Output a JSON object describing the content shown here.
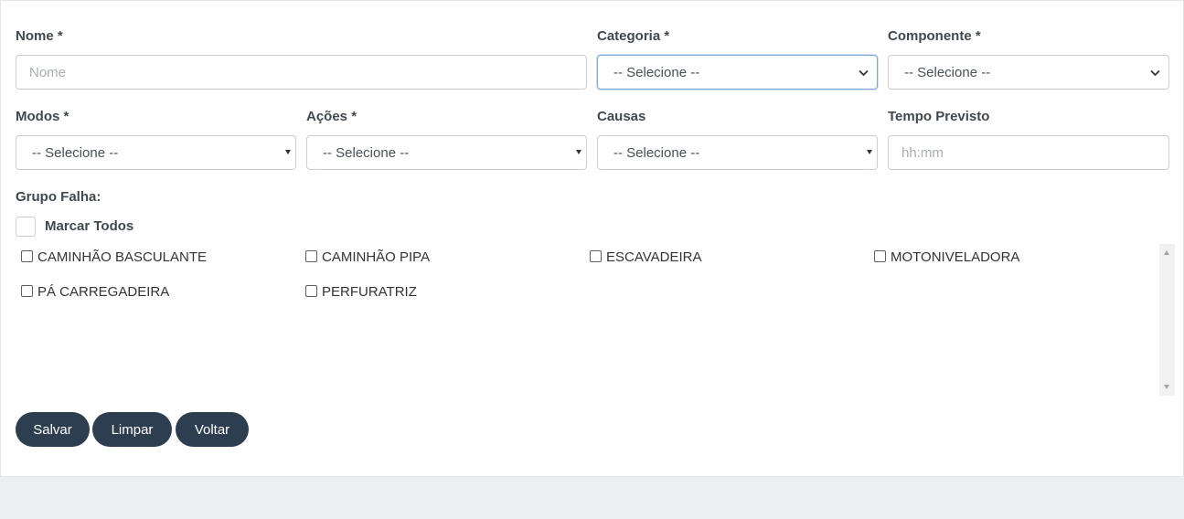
{
  "form": {
    "nome": {
      "label": "Nome *",
      "placeholder": "Nome"
    },
    "categoria": {
      "label": "Categoria *",
      "value": "-- Selecione --"
    },
    "componente": {
      "label": "Componente *",
      "value": "-- Selecione --"
    },
    "modos": {
      "label": "Modos *",
      "value": "-- Selecione --"
    },
    "acoes": {
      "label": "Ações *",
      "value": "-- Selecione --"
    },
    "causas": {
      "label": "Causas",
      "value": "-- Selecione --"
    },
    "tempo": {
      "label": "Tempo Previsto",
      "placeholder": "hh:mm"
    }
  },
  "grupo": {
    "label": "Grupo Falha:",
    "select_all": "Marcar Todos",
    "options": [
      "CAMINHÃO BASCULANTE",
      "CAMINHÃO PIPA",
      "ESCAVADEIRA",
      "MOTONIVELADORA",
      "PÁ CARREGADEIRA",
      "PERFURATRIZ"
    ]
  },
  "buttons": {
    "save": "Salvar",
    "clear": "Limpar",
    "back": "Voltar"
  },
  "colors": {
    "button_bg": "#2d3e50",
    "page_bg": "#ecefef",
    "focus_border": "#7ea7d8"
  }
}
